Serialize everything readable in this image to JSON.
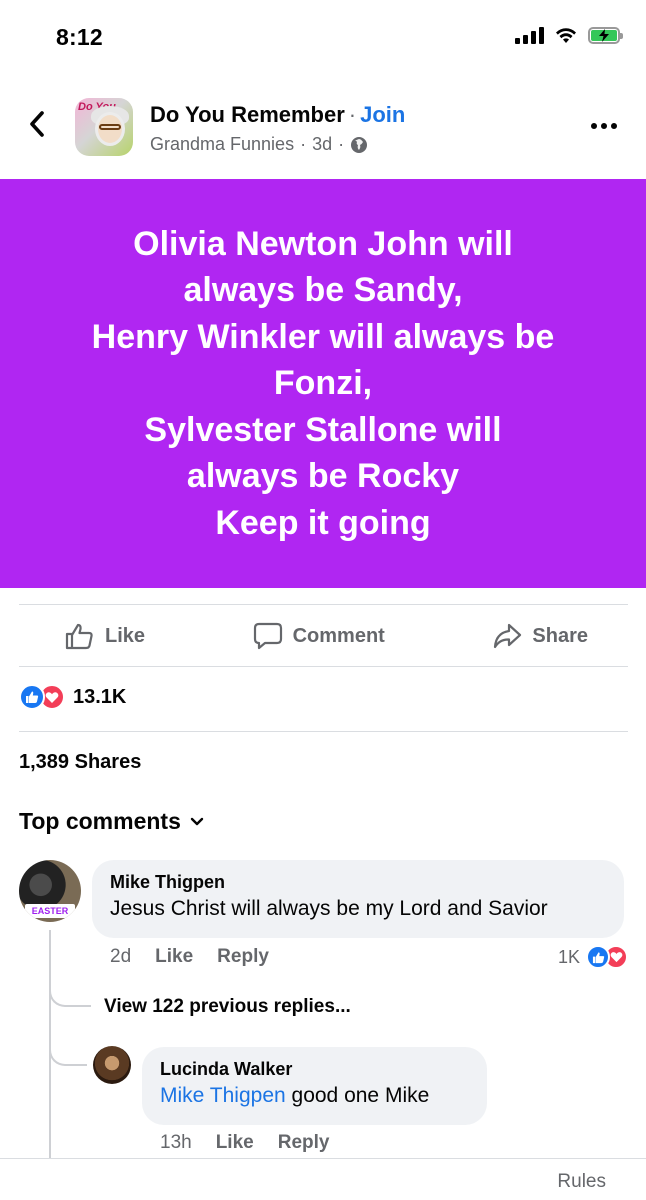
{
  "status_bar": {
    "time": "8:12",
    "icons": [
      "signal-icon",
      "wifi-icon",
      "battery-charging-icon"
    ]
  },
  "header": {
    "back_icon": "chevron-left-icon",
    "group_name": "Do You Remember",
    "separator": "·",
    "join_label": "Join",
    "author": "Grandma Funnies",
    "time_ago": "3d",
    "privacy_icon": "globe-icon",
    "more_icon": "more-horizontal-icon",
    "avatar_text": "Do You"
  },
  "post": {
    "background_color": "#b026f2",
    "lines": [
      "Olivia Newton John will",
      "always be Sandy,",
      "Henry Winkler will always be",
      "Fonzi,",
      "Sylvester Stallone will",
      "always be Rocky",
      "Keep it going"
    ]
  },
  "actions": {
    "like": "Like",
    "comment": "Comment",
    "share": "Share"
  },
  "stats": {
    "reactions_count": "13.1K",
    "shares": "1,389 Shares"
  },
  "comments_section": {
    "sort_label": "Top comments",
    "comments": [
      {
        "author": "Mike Thigpen",
        "text": "Jesus Christ will always be my Lord and Savior",
        "time": "2d",
        "like_label": "Like",
        "reply_label": "Reply",
        "reaction_count": "1K",
        "avatar_banner": "EASTER"
      }
    ],
    "view_replies_label": "View 122 previous replies...",
    "reply": {
      "author": "Lucinda Walker",
      "mention": "Mike Thigpen",
      "text": " good one Mike",
      "time": "13h",
      "like_label": "Like",
      "reply_label": "Reply"
    }
  },
  "footer": {
    "rules_label": "Rules"
  }
}
